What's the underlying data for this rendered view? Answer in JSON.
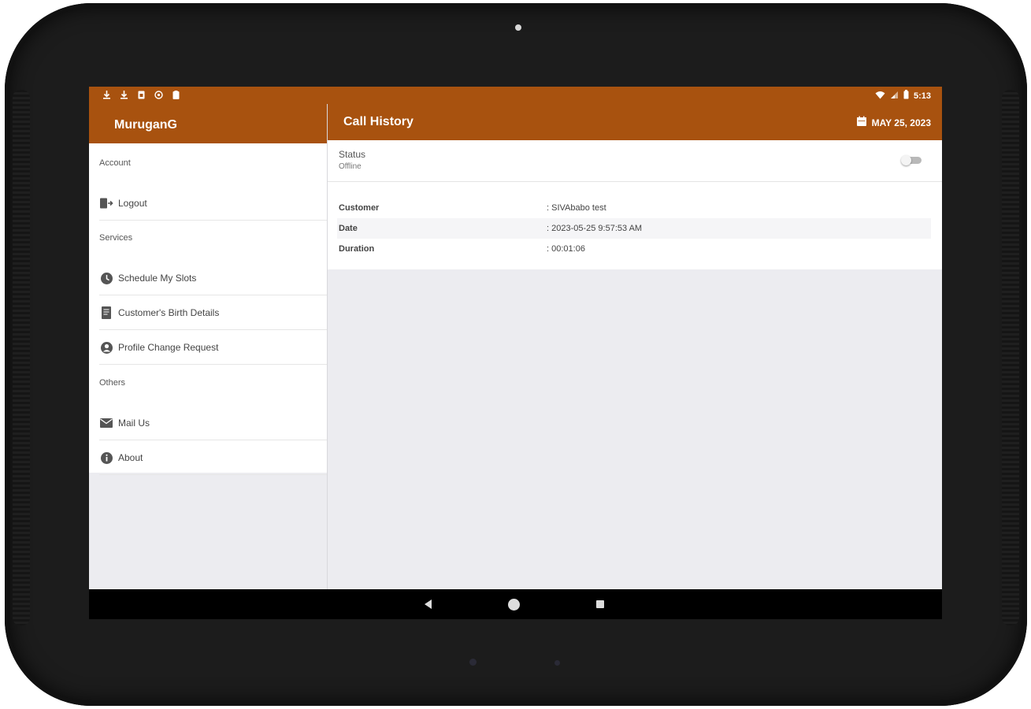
{
  "statusbar": {
    "time": "5:13",
    "left_icons": [
      "download-icon",
      "download-icon",
      "sim-icon",
      "circle-icon",
      "clipboard-icon"
    ],
    "right_icons": [
      "wifi-icon",
      "signal-icon",
      "battery-icon"
    ]
  },
  "drawer": {
    "user_name": "MuruganG",
    "sections": {
      "account": "Account",
      "services": "Services",
      "others": "Others"
    },
    "items": [
      {
        "label": "Logout",
        "icon": "logout-icon"
      },
      {
        "label": "Schedule My Slots",
        "icon": "clock-icon"
      },
      {
        "label": "Customer's Birth Details",
        "icon": "document-icon"
      },
      {
        "label": "Profile Change Request",
        "icon": "account-circle-icon"
      },
      {
        "label": "Mail Us",
        "icon": "mail-icon"
      },
      {
        "label": "About",
        "icon": "info-icon"
      }
    ]
  },
  "main": {
    "title": "Call History",
    "date": "MAY 25, 2023",
    "status": {
      "label": "Status",
      "value": "Offline",
      "toggle_on": false
    },
    "details": [
      {
        "key": "Customer",
        "value": ": SIVAbabo test"
      },
      {
        "key": "Date",
        "value": ": 2023-05-25 9:57:53 AM"
      },
      {
        "key": "Duration",
        "value": ": 00:01:06"
      }
    ]
  },
  "colors": {
    "primary": "#a8520f",
    "background": "#ececf0",
    "surface": "#ffffff"
  }
}
